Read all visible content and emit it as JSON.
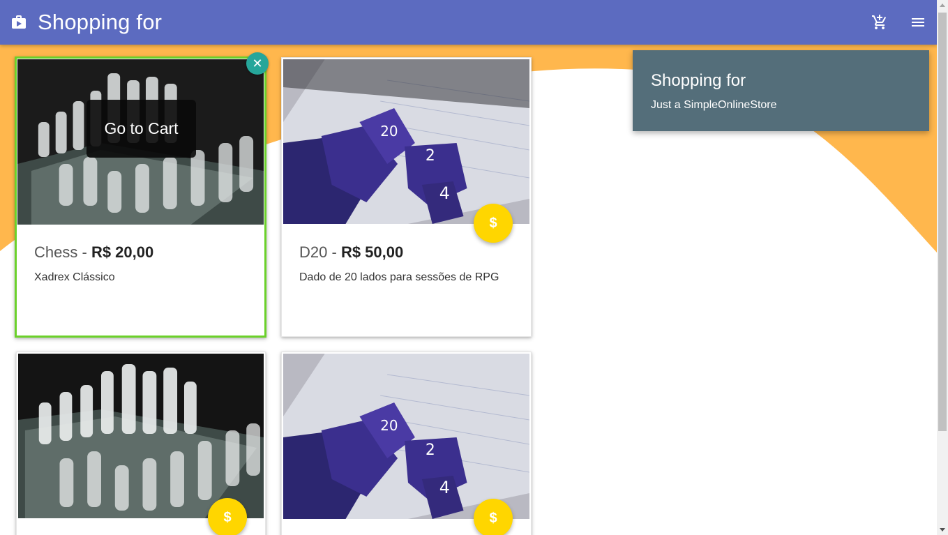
{
  "appbar": {
    "title": "Shopping for",
    "brand_icon": "shopping-bag-icon",
    "cart_icon": "add-shopping-cart-icon",
    "menu_icon": "menu-icon",
    "color": "#5c6bc0"
  },
  "info_panel": {
    "title": "Shopping for",
    "subtitle": "Just a SimpleOnlineStore",
    "color": "#546e7a"
  },
  "overlay": {
    "go_to_cart_label": "Go to Cart",
    "close_symbol": "✕"
  },
  "products": [
    {
      "name": "Chess",
      "separator": "-",
      "price": "R$ 20,00",
      "description": "Xadrex Clássico",
      "image": "chess-board-photo",
      "selected": true
    },
    {
      "name": "D20",
      "separator": "-",
      "price": "R$ 50,00",
      "description": "Dado de 20 lados para sessões de RPG",
      "image": "purple-dice-photo",
      "selected": false
    },
    {
      "name": "",
      "separator": "",
      "price": "",
      "description": "",
      "image": "chess-board-photo",
      "selected": false
    },
    {
      "name": "",
      "separator": "",
      "price": "",
      "description": "",
      "image": "purple-dice-photo",
      "selected": false
    }
  ],
  "buy_symbol": "$",
  "colors": {
    "accent_wave": "#ffb74d",
    "buy_button": "#ffd600",
    "selected_border": "#6bd12a",
    "close_button": "#26a69a"
  }
}
